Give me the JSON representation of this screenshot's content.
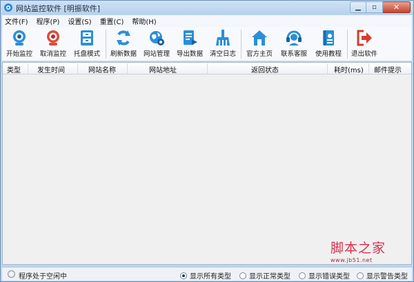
{
  "window": {
    "title": "网站监控软件 [明振软件]"
  },
  "menu": [
    {
      "label": "文件(F)"
    },
    {
      "label": "程序(P)"
    },
    {
      "label": "设置(S)"
    },
    {
      "label": "重置(C)"
    },
    {
      "label": "帮助(H)"
    }
  ],
  "toolbar": [
    {
      "label": "开始监控",
      "icon": "webcam-icon"
    },
    {
      "label": "取消监控",
      "icon": "webcam-off-icon"
    },
    {
      "label": "托盘模式",
      "icon": "tray-icon"
    },
    {
      "label": "刷新数据",
      "icon": "refresh-icon"
    },
    {
      "label": "网站管理",
      "icon": "globe-settings-icon"
    },
    {
      "label": "导出数据",
      "icon": "export-icon"
    },
    {
      "label": "清空日志",
      "icon": "broom-icon"
    },
    {
      "label": "官方主页",
      "icon": "home-icon"
    },
    {
      "label": "联系客服",
      "icon": "headset-icon"
    },
    {
      "label": "使用教程",
      "icon": "book-icon"
    },
    {
      "label": "退出软件",
      "icon": "exit-icon"
    }
  ],
  "table": {
    "columns": [
      "类型",
      "发生时间",
      "网站名称",
      "网站地址",
      "返回状态",
      "耗时(ms)",
      "邮件提示"
    ]
  },
  "watermark": {
    "main": "脚本之家",
    "sub": "www.jb51.net"
  },
  "status": {
    "text": "程序处于空闲中",
    "filters": [
      {
        "label": "显示所有类型",
        "selected": true
      },
      {
        "label": "显示正常类型",
        "selected": false
      },
      {
        "label": "显示错误类型",
        "selected": false
      },
      {
        "label": "显示警告类型",
        "selected": false
      }
    ]
  },
  "colors": {
    "accent": "#1e7fd0",
    "danger": "#d83a2e",
    "title_bg": "#bcd6ee"
  }
}
